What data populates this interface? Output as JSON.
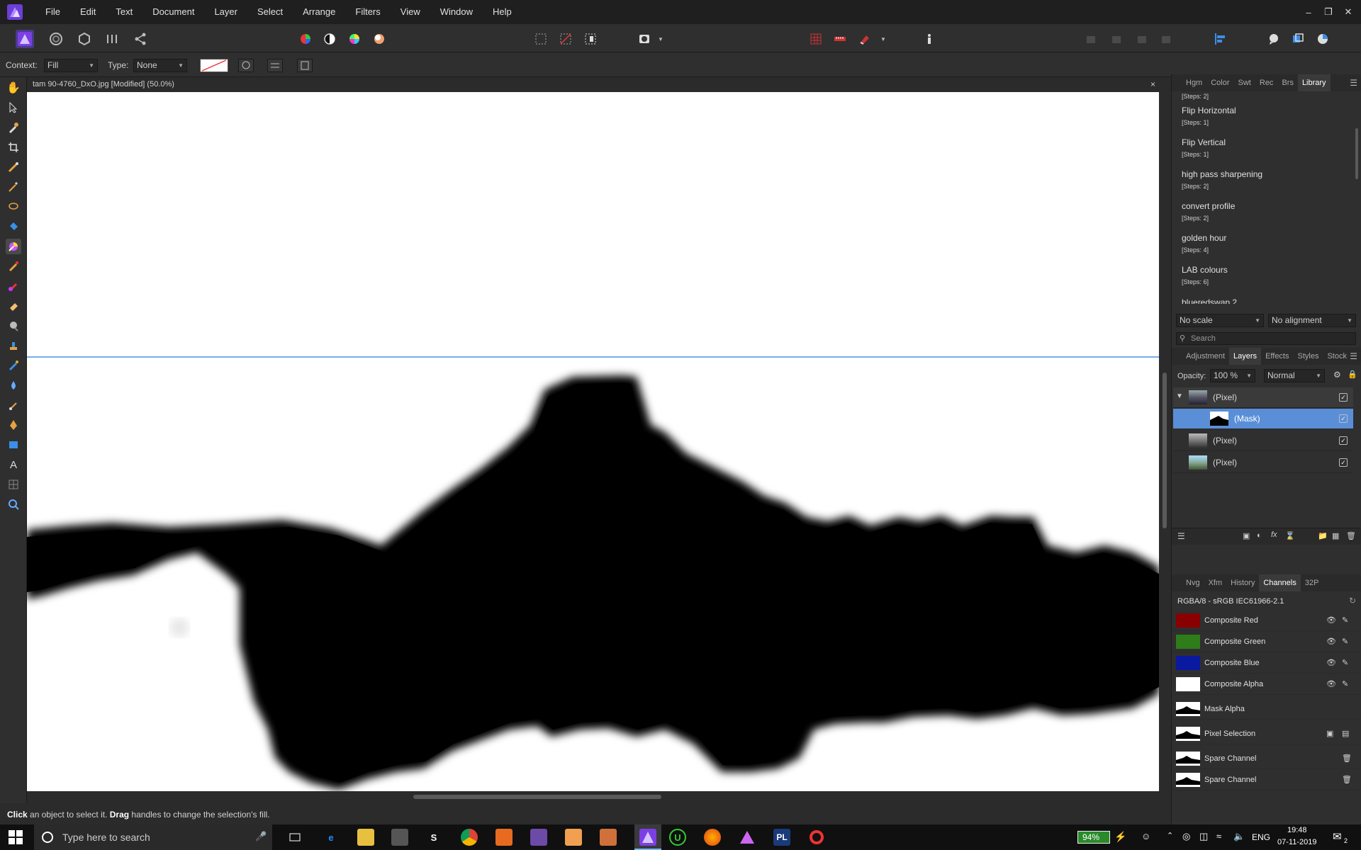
{
  "menubar": {
    "items": [
      "File",
      "Edit",
      "Text",
      "Document",
      "Layer",
      "Select",
      "Arrange",
      "Filters",
      "View",
      "Window",
      "Help"
    ]
  },
  "context_bar": {
    "context_label": "Context:",
    "context_value": "Fill",
    "type_label": "Type:",
    "type_value": "None"
  },
  "document": {
    "tab_title": "tam 90-4760_DxO.jpg [Modified] (50.0%)",
    "close_symbol": "×"
  },
  "status": {
    "click_word": "Click",
    "text1": " an object to select it. ",
    "drag_word": "Drag",
    "text2": " handles to change the selection's fill."
  },
  "library_panel": {
    "tabs": [
      "Hgm",
      "Color",
      "Swt",
      "Rec",
      "Brs",
      "Library"
    ],
    "active_tab": "Library",
    "top_partial_steps": "[Steps: 2]",
    "macros": [
      {
        "name": "Flip Horizontal",
        "steps": "[Steps: 1]"
      },
      {
        "name": "Flip Vertical",
        "steps": "[Steps: 1]"
      },
      {
        "name": "high pass sharpening",
        "steps": "[Steps: 2]"
      },
      {
        "name": "convert profile",
        "steps": "[Steps: 2]"
      },
      {
        "name": "golden hour",
        "steps": "[Steps: 4]"
      },
      {
        "name": "LAB colours",
        "steps": "[Steps: 6]"
      }
    ],
    "partial_last": "blueredswap 2",
    "scale": "No scale",
    "alignment": "No alignment",
    "search_placeholder": "Search"
  },
  "layers_panel": {
    "tabs": [
      "Adjustment",
      "Layers",
      "Effects",
      "Styles",
      "Stock"
    ],
    "active_tab": "Layers",
    "opacity_label": "Opacity:",
    "opacity_value": "100 %",
    "blend_mode": "Normal",
    "layers": [
      {
        "name": "(Pixel)",
        "selected": false
      },
      {
        "name": "(Mask)",
        "selected": true
      },
      {
        "name": "(Pixel)",
        "selected": false
      },
      {
        "name": "(Pixel)",
        "selected": false
      }
    ]
  },
  "channels_panel": {
    "tabs": [
      "Nvg",
      "Xfm",
      "History",
      "Channels",
      "32P"
    ],
    "active_tab": "Channels",
    "profile": "RGBA/8 - sRGB IEC61966-2.1",
    "channels": [
      {
        "name": "Composite Red",
        "color": "#8a0000"
      },
      {
        "name": "Composite Green",
        "color": "#2e7d1a"
      },
      {
        "name": "Composite Blue",
        "color": "#0a1aa0"
      },
      {
        "name": "Composite Alpha",
        "color": "#ffffff"
      },
      {
        "name": "Mask Alpha",
        "color": "#ffffff"
      },
      {
        "name": "Pixel Selection",
        "color": "#ffffff"
      },
      {
        "name": "Spare Channel",
        "color": "#ffffff"
      },
      {
        "name": "Spare Channel",
        "color": "#ffffff"
      }
    ]
  },
  "taskbar": {
    "search_placeholder": "Type here to search",
    "battery": "94%",
    "language": "ENG",
    "time": "19:48",
    "date": "07-11-2019",
    "notification_count": "2"
  },
  "colors": {
    "accent": "#5a8fd8",
    "app_bg": "#2f2f2f",
    "affinity_purple": "#7b3fe4"
  }
}
